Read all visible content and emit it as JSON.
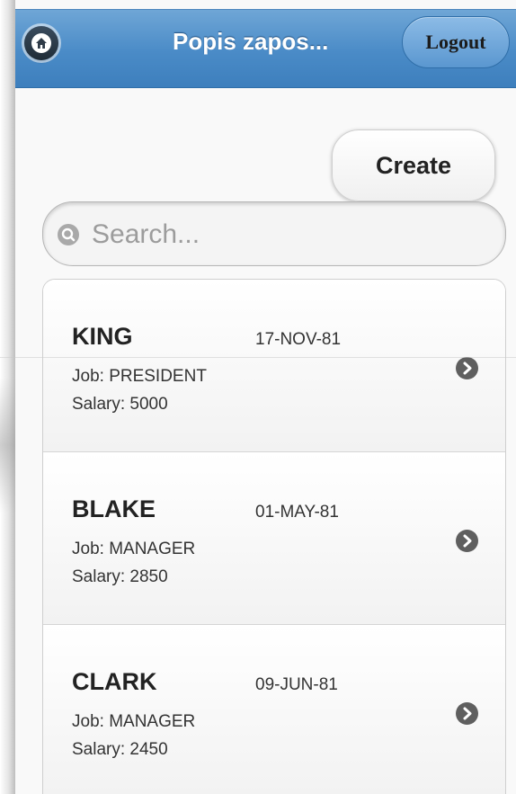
{
  "header": {
    "title": "Popis zapos...",
    "logout_label": "Logout"
  },
  "toolbar": {
    "create_label": "Create"
  },
  "search": {
    "placeholder": "Search...",
    "value": ""
  },
  "employees": [
    {
      "name": "KING",
      "date": "17-NOV-81",
      "job": "Job: PRESIDENT",
      "salary": "Salary: 5000"
    },
    {
      "name": "BLAKE",
      "date": "01-MAY-81",
      "job": "Job: MANAGER",
      "salary": "Salary: 2850"
    },
    {
      "name": "CLARK",
      "date": "09-JUN-81",
      "job": "Job: MANAGER",
      "salary": "Salary: 2450"
    }
  ],
  "icons": {
    "home": "home-icon",
    "search": "search-icon",
    "chevron": "chevron-right-icon"
  },
  "colors": {
    "header_blue": "#4a8bc7",
    "logout_blue": "#6ea6dc",
    "chevron_gray": "#5f5f5f"
  }
}
